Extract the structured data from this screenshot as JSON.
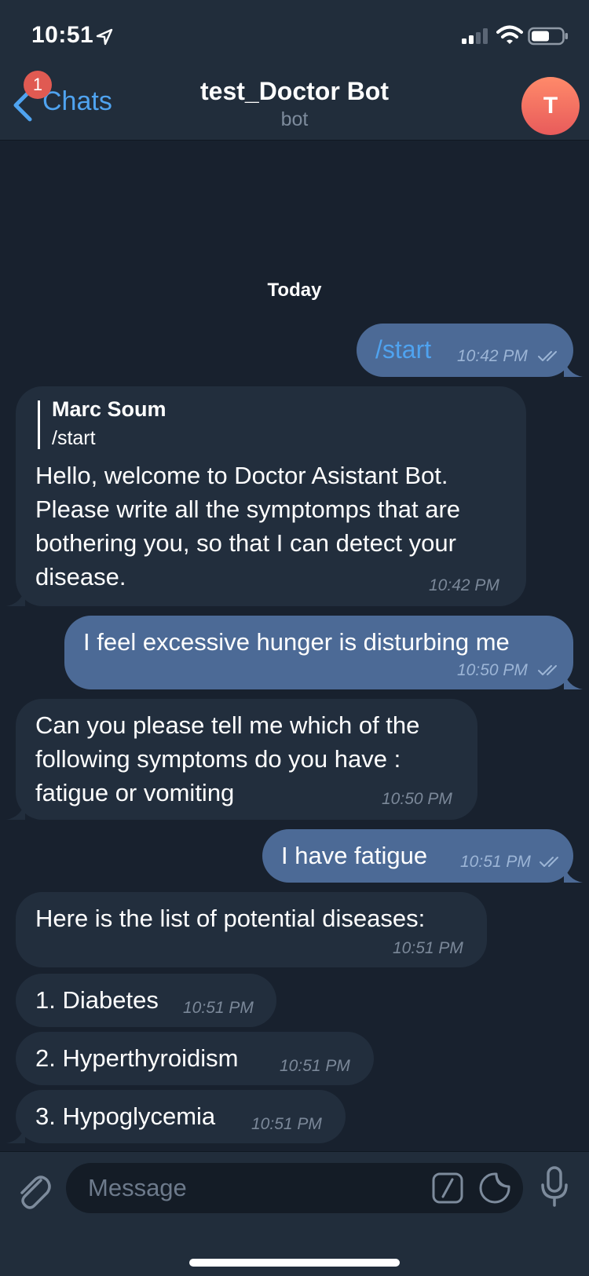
{
  "status_bar": {
    "time": "10:51"
  },
  "header": {
    "back_label": "Chats",
    "unread_count": "1",
    "title": "test_Doctor Bot",
    "subtitle": "bot",
    "avatar_initial": "T"
  },
  "date_separator": "Today",
  "messages": [
    {
      "direction": "out",
      "text": "/start",
      "time": "10:42 PM",
      "read": true
    },
    {
      "direction": "in",
      "reply_to": {
        "name": "Marc Soum",
        "text": "/start"
      },
      "text": "Hello, welcome to Doctor Asistant Bot.\nPlease write all the symptomps that are\nbothering you, so that I can detect your\ndisease.",
      "time": "10:42 PM"
    },
    {
      "direction": "out",
      "text": "I feel excessive hunger is disturbing me",
      "time": "10:50 PM",
      "read": true
    },
    {
      "direction": "in",
      "text": "Can you please tell me which of the\nfollowing symptoms do you have :\nfatigue or vomiting",
      "time": "10:50 PM"
    },
    {
      "direction": "out",
      "text": "I have fatigue",
      "time": "10:51 PM",
      "read": true
    },
    {
      "direction": "in",
      "text": "Here is the list of potential diseases:",
      "time": "10:51 PM"
    },
    {
      "direction": "in",
      "text": "1. Diabetes",
      "time": "10:51 PM"
    },
    {
      "direction": "in",
      "text": "2. Hyperthyroidism",
      "time": "10:51 PM"
    },
    {
      "direction": "in",
      "text": "3. Hypoglycemia",
      "time": "10:51 PM"
    }
  ],
  "composer": {
    "placeholder": "Message"
  },
  "colors": {
    "background": "#18212e",
    "bar": "#212d3b",
    "outgoing_bubble": "#4c6a96",
    "incoming_bubble": "#222e3d",
    "accent": "#4fa3f0",
    "badge": "#e05a52"
  },
  "icons": [
    "location-arrow-icon",
    "signal-icon",
    "wifi-icon",
    "battery-icon",
    "back-chevron-icon",
    "paperclip-icon",
    "bot-command-icon",
    "sticker-icon",
    "microphone-icon",
    "double-check-icon"
  ]
}
